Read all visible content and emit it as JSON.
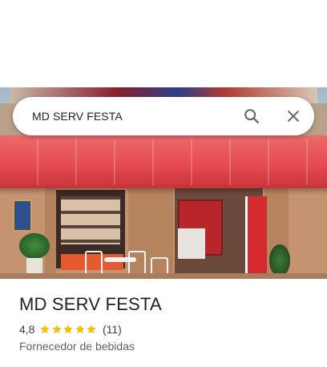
{
  "search": {
    "query": "MD SERV FESTA"
  },
  "icons": {
    "search": "search-icon",
    "close": "close-icon",
    "star": "star-icon"
  },
  "colors": {
    "star": "#fbbc04",
    "awning": "#e34a4e"
  },
  "place": {
    "name": "MD SERV FESTA",
    "rating": "4,8",
    "rating_value": 4.8,
    "star_count": 5,
    "reviews": "(11)",
    "category": "Fornecedor de bebidas"
  }
}
